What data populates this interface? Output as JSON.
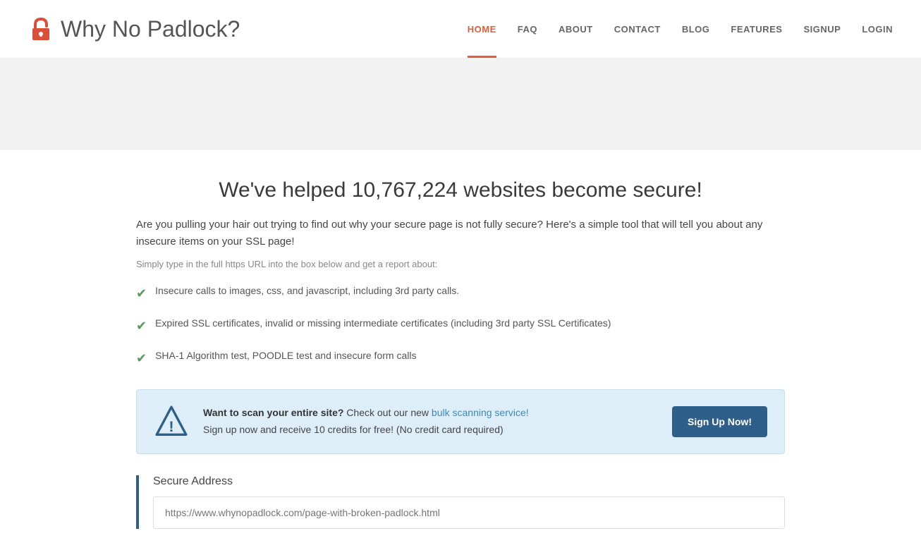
{
  "header": {
    "logo_text": "Why No Padlock?",
    "nav_items": [
      {
        "label": "HOME",
        "active": true
      },
      {
        "label": "FAQ",
        "active": false
      },
      {
        "label": "ABOUT",
        "active": false
      },
      {
        "label": "CONTACT",
        "active": false
      },
      {
        "label": "BLOG",
        "active": false
      },
      {
        "label": "FEATURES",
        "active": false
      },
      {
        "label": "SIGNUP",
        "active": false
      },
      {
        "label": "LOGIN",
        "active": false
      }
    ]
  },
  "main": {
    "headline": "We've helped 10,767,224 websites become secure!",
    "intro": "Are you pulling your hair out trying to find out why your secure page is not fully secure? Here's a simple tool that will tell you about any insecure items on your SSL page!",
    "sub_text": "Simply type in the full https URL into the box below and get a report about:",
    "features": [
      "Insecure calls to images, css, and javascript, including 3rd party calls.",
      "Expired SSL certificates, invalid or missing intermediate certificates (including 3rd party SSL Certificates)",
      "SHA-1 Algorithm test, POODLE test and insecure form calls"
    ],
    "promo": {
      "bold_text": "Want to scan your entire site?",
      "link_text": "bulk scanning service!",
      "after_link": "",
      "line2": "Sign up now and receive 10 credits for free! (No credit card required)",
      "button_label": "Sign Up Now!"
    },
    "form": {
      "label": "Secure Address",
      "placeholder": "https://www.whynopadlock.com/page-with-broken-padlock.html"
    }
  }
}
